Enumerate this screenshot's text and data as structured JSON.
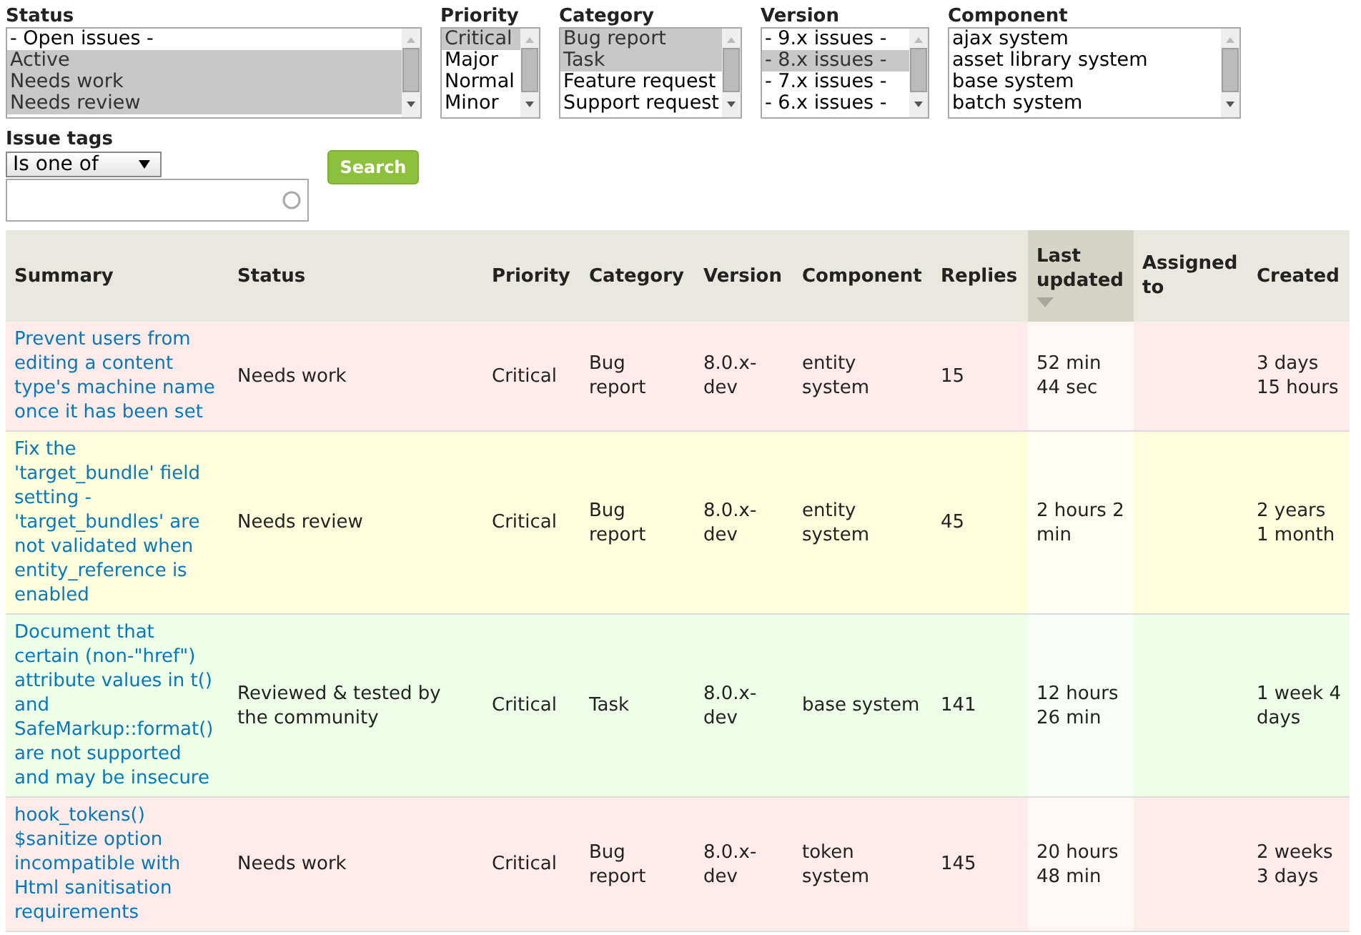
{
  "filters": [
    {
      "label": "Status",
      "options": [
        {
          "text": "- Open issues -",
          "selected": false
        },
        {
          "text": "Active",
          "selected": true
        },
        {
          "text": "Needs work",
          "selected": true
        },
        {
          "text": "Needs review",
          "selected": true
        }
      ]
    },
    {
      "label": "Priority",
      "options": [
        {
          "text": "Critical",
          "selected": true
        },
        {
          "text": "Major",
          "selected": false
        },
        {
          "text": "Normal",
          "selected": false
        },
        {
          "text": "Minor",
          "selected": false
        }
      ]
    },
    {
      "label": "Category",
      "options": [
        {
          "text": "Bug report",
          "selected": true
        },
        {
          "text": "Task",
          "selected": true
        },
        {
          "text": "Feature request",
          "selected": false
        },
        {
          "text": "Support request",
          "selected": false
        }
      ]
    },
    {
      "label": "Version",
      "options": [
        {
          "text": "- 9.x issues -",
          "selected": false
        },
        {
          "text": "- 8.x issues -",
          "selected": true
        },
        {
          "text": "- 7.x issues -",
          "selected": false
        },
        {
          "text": "- 6.x issues -",
          "selected": false
        }
      ]
    },
    {
      "label": "Component",
      "options": [
        {
          "text": "ajax system",
          "selected": false
        },
        {
          "text": "asset library system",
          "selected": false
        },
        {
          "text": "base system",
          "selected": false
        },
        {
          "text": "batch system",
          "selected": false
        }
      ]
    }
  ],
  "issue_tags": {
    "label": "Issue tags",
    "operator": "Is one of"
  },
  "search_button": "Search",
  "table": {
    "columns": [
      {
        "label": "Summary",
        "sorted": false
      },
      {
        "label": "Status",
        "sorted": false
      },
      {
        "label": "Priority",
        "sorted": false
      },
      {
        "label": "Category",
        "sorted": false
      },
      {
        "label": "Version",
        "sorted": false
      },
      {
        "label": "Component",
        "sorted": false
      },
      {
        "label": "Replies",
        "sorted": false
      },
      {
        "label": "Last updated",
        "sorted": true
      },
      {
        "label": "Assigned to",
        "sorted": false
      },
      {
        "label": "Created",
        "sorted": false
      }
    ],
    "rows": [
      {
        "color": "#ffebe9",
        "cells": [
          "Prevent users from editing a content type's machine name once it has been set",
          "Needs work",
          "Critical",
          "Bug report",
          "8.0.x-dev",
          "entity system",
          "15",
          "52 min 44 sec",
          "",
          "3 days 15 hours"
        ]
      },
      {
        "color": "#ffffdd",
        "cells": [
          "Fix the 'target_bundle' field setting - 'target_bundles' are not validated when entity_reference is enabled",
          "Needs review",
          "Critical",
          "Bug report",
          "8.0.x-dev",
          "entity system",
          "45",
          "2 hours 2 min",
          "",
          "2 years 1 month"
        ]
      },
      {
        "color": "#eeffe8",
        "cells": [
          "Document that certain (non-\"href\") attribute values in t() and SafeMarkup::format() are not supported and may be insecure",
          "Reviewed & tested by the community",
          "Critical",
          "Task",
          "8.0.x-dev",
          "base system",
          "141",
          "12 hours 26 min",
          "",
          "1 week 4 days"
        ]
      },
      {
        "color": "#ffebe9",
        "cells": [
          "hook_tokens() $sanitize option incompatible with Html sanitisation requirements",
          "Needs work",
          "Critical",
          "Bug report",
          "8.0.x-dev",
          "token system",
          "145",
          "20 hours 48 min",
          "",
          "2 weeks 3 days"
        ]
      }
    ]
  }
}
